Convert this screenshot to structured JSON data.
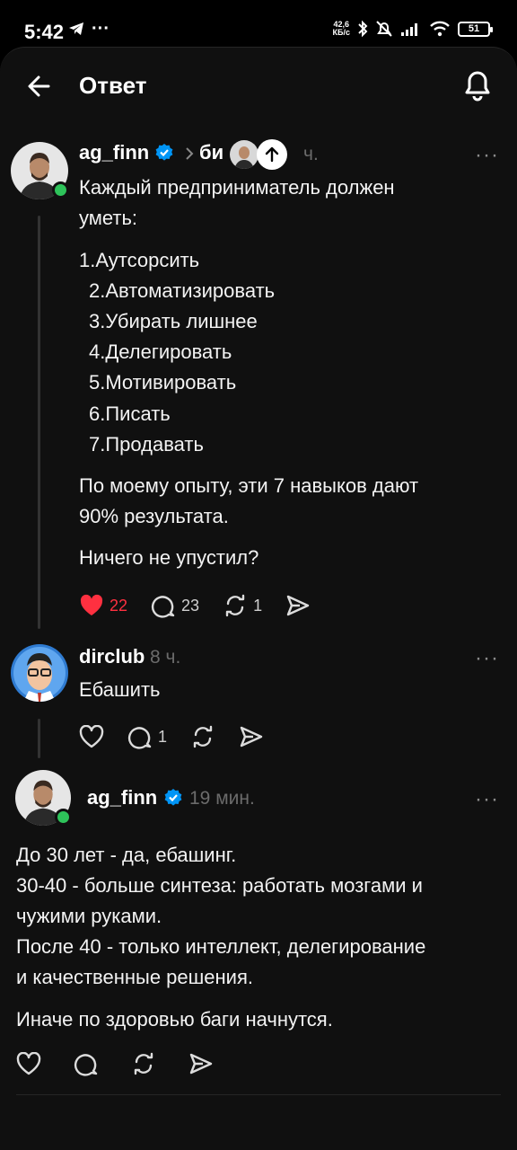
{
  "status_bar": {
    "time": "5:42",
    "speed_value": "42,6",
    "speed_unit": "КБ/с",
    "battery": "51"
  },
  "header": {
    "title": "Ответ"
  },
  "post1": {
    "author": "ag_finn",
    "breadcrumb": "би",
    "time": "ч.",
    "text_lines": [
      "Каждый предприниматель должен",
      "уметь:"
    ],
    "list": [
      "1.Аутсорсить",
      "2.Автоматизировать",
      "3.Убирать лишнее",
      "4.Делегировать",
      "5.Мотивировать",
      "6.Писать",
      "7.Продавать"
    ],
    "text2_lines": [
      "По моему опыту, эти 7 навыков дают",
      "90% результата."
    ],
    "text3": "Ничего не упустил?",
    "likes": "22",
    "comments": "23",
    "reposts": "1",
    "like_color": "#ff3040"
  },
  "post2": {
    "author": "dirclub",
    "time": "8 ч.",
    "text": "Ебашить",
    "comments": "1"
  },
  "post3": {
    "author": "ag_finn",
    "time": "19 мин.",
    "text_lines": [
      "До 30 лет - да, ебашинг.",
      "30-40 - больше синтеза: работать мозгами и",
      "чужими руками.",
      "После 40 - только интеллект, делегирование",
      "и качественные решения."
    ],
    "text2": "Иначе по здоровью баги начнутся."
  },
  "colors": {
    "verified": "#0095f6",
    "online": "#2ec35a",
    "background": "#101010"
  }
}
